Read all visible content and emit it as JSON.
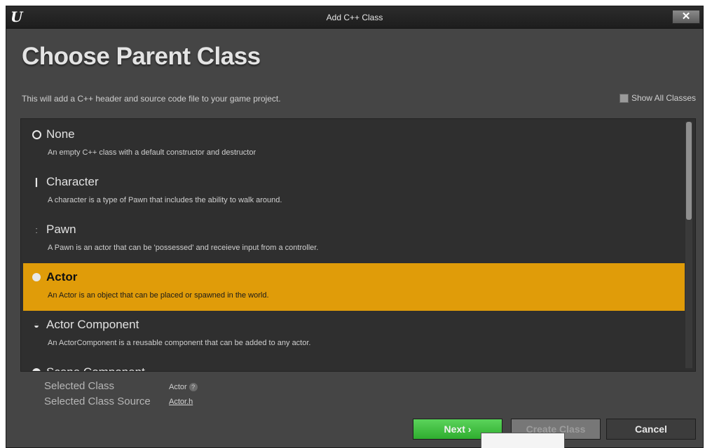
{
  "window": {
    "title": "Add C++ Class",
    "close_label": "✕"
  },
  "heading": "Choose Parent Class",
  "description": "This will add a C++ header and source code file to your game project.",
  "show_all": {
    "label": "Show All Classes",
    "checked": false
  },
  "classes": [
    {
      "name": "None",
      "description": "An empty C++ class with a default constructor and destructor",
      "icon": "ring-icon"
    },
    {
      "name": "Character",
      "description": "A character is a type of Pawn that includes the ability to walk around.",
      "icon": "character-icon"
    },
    {
      "name": "Pawn",
      "description": "A Pawn is an actor that can be 'possessed' and receieve input from a controller.",
      "icon": "pawn-icon"
    },
    {
      "name": "Actor",
      "description": "An Actor is an object that can be placed or spawned in the world.",
      "icon": "actor-icon",
      "selected": true
    },
    {
      "name": "Actor Component",
      "description": "An ActorComponent is a reusable component that can be added to any actor.",
      "icon": "actor-component-icon"
    },
    {
      "name": "Scene Component",
      "description": "",
      "icon": "scene-component-icon"
    }
  ],
  "selected": {
    "class_label": "Selected Class",
    "class_value": "Actor",
    "source_label": "Selected Class Source",
    "source_value": "Actor.h"
  },
  "buttons": {
    "next": "Next ›",
    "create": "Create Class",
    "cancel": "Cancel"
  },
  "colors": {
    "selection": "#e09c09",
    "next_button": "#3cbc3c",
    "panel": "#2f2f2f"
  }
}
